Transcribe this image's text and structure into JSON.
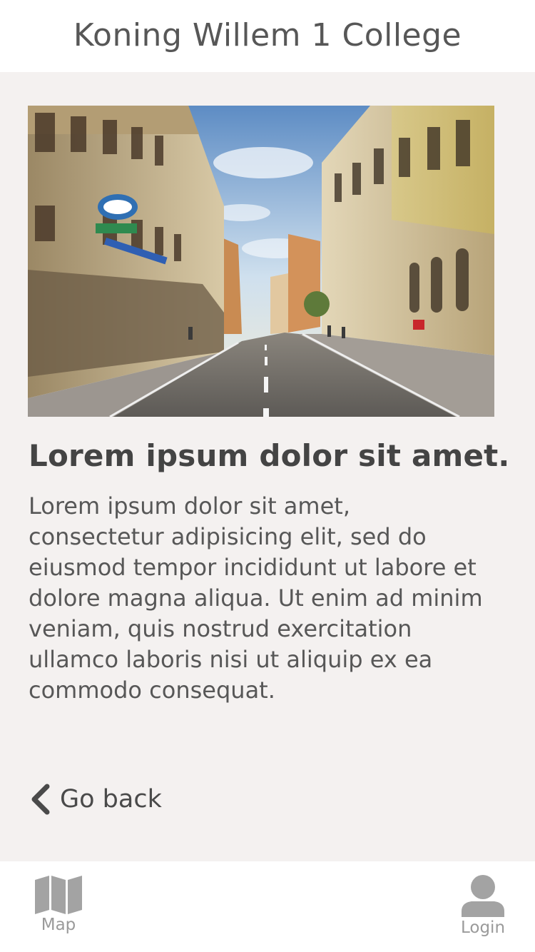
{
  "header": {
    "title": "Koning Willem 1 College"
  },
  "hero": {
    "image_icon": "street-photo"
  },
  "article": {
    "title": "Lorem ipsum dolor sit amet.",
    "body": "Lorem ipsum dolor sit amet, consectetur adipisicing elit, sed do eiusmod tempor incididunt ut labore et dolore magna aliqua. Ut enim ad minim veniam, quis nostrud exercitation ullamco laboris nisi ut aliquip ex ea commodo consequat."
  },
  "back": {
    "label": "Go back",
    "icon": "chevron-left-icon"
  },
  "tabbar": {
    "items": [
      {
        "label": "Map",
        "icon": "map-icon"
      },
      {
        "label": "Login",
        "icon": "user-icon"
      }
    ]
  },
  "colors": {
    "background": "#f4f1f0",
    "header_bg": "#ffffff",
    "text_dark": "#444444",
    "tab_icon": "#9a9a9a"
  }
}
